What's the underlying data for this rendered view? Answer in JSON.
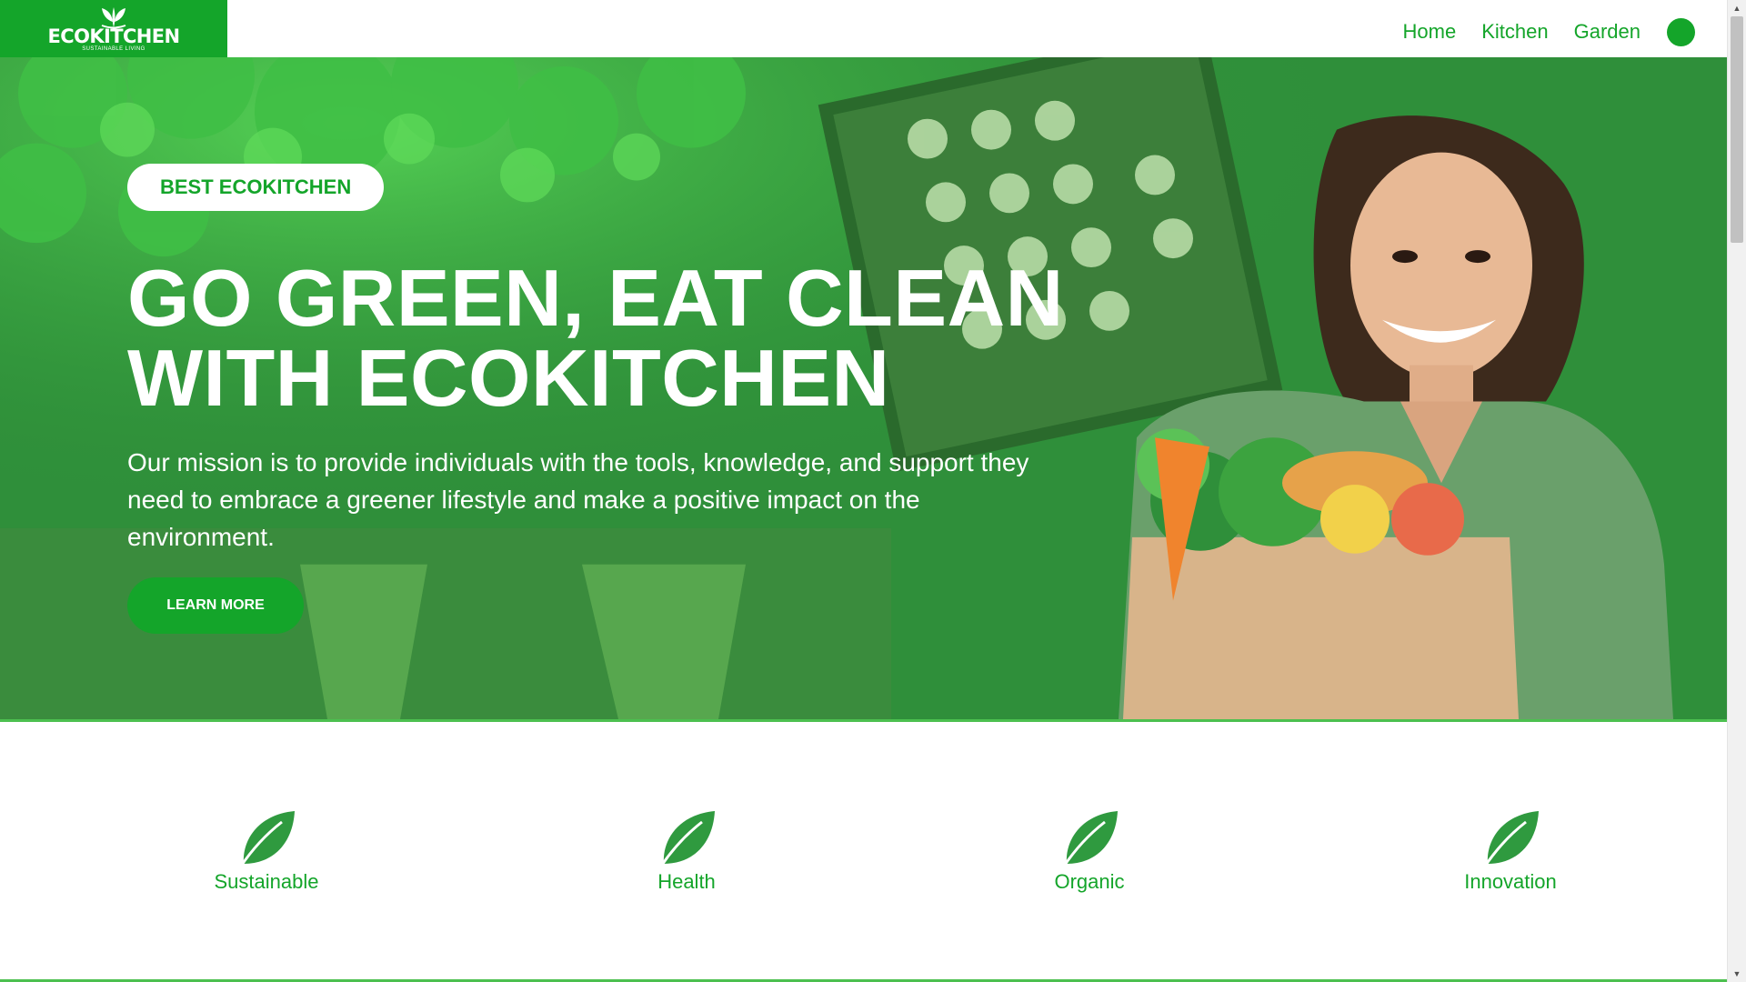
{
  "header": {
    "logo_title": "ECOKITCHEN",
    "logo_subtitle": "SUSTAINABLE LIVING",
    "nav": [
      {
        "label": "Home"
      },
      {
        "label": "Kitchen"
      },
      {
        "label": "Garden"
      }
    ]
  },
  "hero": {
    "badge": "BEST ECOKITCHEN",
    "title_line1": "GO GREEN, EAT CLEAN",
    "title_line2": "WITH ECOKITCHEN",
    "text": "Our mission is to provide individuals with the tools, knowledge, and support they need to embrace a greener lifestyle and make a positive impact on the environment.",
    "button": "LEARN MORE"
  },
  "features": [
    {
      "label": "Sustainable",
      "icon": "leaf-icon"
    },
    {
      "label": "Health",
      "icon": "leaf-icon"
    },
    {
      "label": "Organic",
      "icon": "leaf-icon"
    },
    {
      "label": "Innovation",
      "icon": "leaf-icon"
    }
  ],
  "colors": {
    "brand_green": "#14a52a",
    "hero_overlay": "#2c8f36",
    "leaf_green": "#2f9a3f",
    "divider_green": "#4cc04f"
  }
}
